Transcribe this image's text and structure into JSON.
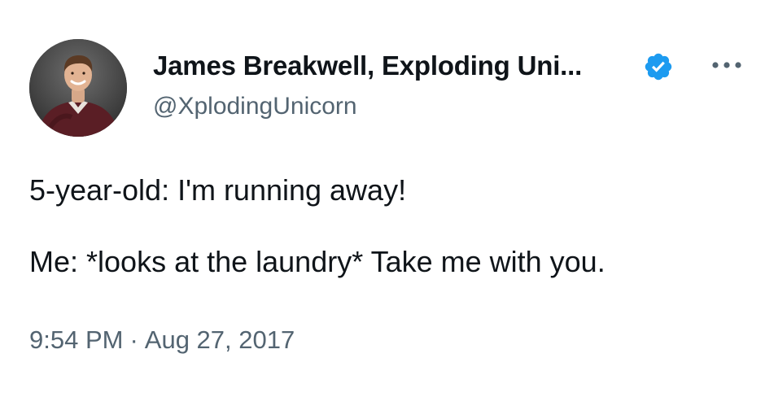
{
  "author": {
    "display_name": "James Breakwell, Exploding Uni...",
    "handle": "@XplodingUnicorn",
    "verified": true,
    "avatar_icon": "profile-photo"
  },
  "menu": {
    "icon": "more-horizontal-icon"
  },
  "tweet": {
    "lines": [
      "5-year-old: I'm running away!",
      "Me: *looks at the laundry* Take me with you."
    ]
  },
  "meta": {
    "time": "9:54 PM",
    "separator": "·",
    "date": "Aug 27, 2017"
  },
  "colors": {
    "primary_text": "#0f1419",
    "secondary_text": "#536471",
    "verified_blue": "#1d9bf0",
    "background": "#ffffff"
  }
}
